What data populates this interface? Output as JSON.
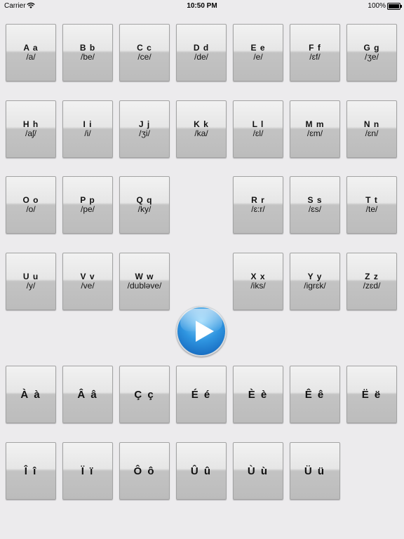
{
  "status_bar": {
    "carrier": "Carrier",
    "time": "10:50 PM",
    "battery": "100%"
  },
  "alphabet_keys": [
    {
      "letter": "A a",
      "phonetic": "/a/"
    },
    {
      "letter": "B b",
      "phonetic": "/be/"
    },
    {
      "letter": "C c",
      "phonetic": "/ce/"
    },
    {
      "letter": "D d",
      "phonetic": "/de/"
    },
    {
      "letter": "E e",
      "phonetic": "/e/"
    },
    {
      "letter": "F f",
      "phonetic": "/ɛf/"
    },
    {
      "letter": "G g",
      "phonetic": "/ʒe/"
    },
    {
      "letter": "H h",
      "phonetic": "/aʃ/"
    },
    {
      "letter": "I i",
      "phonetic": "/i/"
    },
    {
      "letter": "J j",
      "phonetic": "/ʒi/"
    },
    {
      "letter": "K k",
      "phonetic": "/ka/"
    },
    {
      "letter": "L l",
      "phonetic": "/ɛl/"
    },
    {
      "letter": "M m",
      "phonetic": "/ɛm/"
    },
    {
      "letter": "N n",
      "phonetic": "/ɛn/"
    },
    {
      "letter": "O o",
      "phonetic": "/o/"
    },
    {
      "letter": "P p",
      "phonetic": "/pe/"
    },
    {
      "letter": "Q q",
      "phonetic": "/ky/"
    },
    {
      "letter": "R r",
      "phonetic": "/ɛ:r/"
    },
    {
      "letter": "S s",
      "phonetic": "/ɛs/"
    },
    {
      "letter": "T t",
      "phonetic": "/te/"
    },
    {
      "letter": "U u",
      "phonetic": "/y/"
    },
    {
      "letter": "V v",
      "phonetic": "/ve/"
    },
    {
      "letter": "W w",
      "phonetic": "/dubləve/"
    },
    {
      "letter": "X x",
      "phonetic": "/iks/"
    },
    {
      "letter": "Y y",
      "phonetic": "/igrɛk/"
    },
    {
      "letter": "Z z",
      "phonetic": "/zɛd/"
    }
  ],
  "accent_keys": [
    {
      "letter": "À à"
    },
    {
      "letter": "Â â"
    },
    {
      "letter": "Ç ç"
    },
    {
      "letter": "É é"
    },
    {
      "letter": "È è"
    },
    {
      "letter": "Ê ê"
    },
    {
      "letter": "Ë ë"
    },
    {
      "letter": "Î î"
    },
    {
      "letter": "Ï ï"
    },
    {
      "letter": "Ô ô"
    },
    {
      "letter": "Û û"
    },
    {
      "letter": "Ù ù"
    },
    {
      "letter": "Ü ü"
    }
  ],
  "play_button": {
    "icon": "play-icon",
    "color": "#2f95e0"
  }
}
